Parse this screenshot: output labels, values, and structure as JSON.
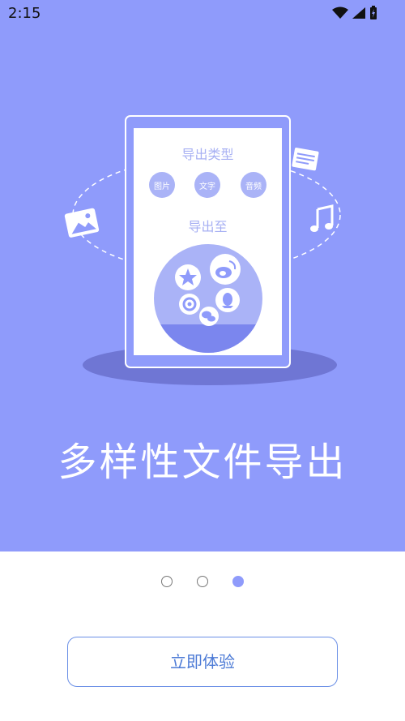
{
  "status_bar": {
    "time": "2:15",
    "icons": [
      "wifi-icon",
      "cellular-signal-icon",
      "battery-charging-icon"
    ]
  },
  "illustration": {
    "export_type_title": "导出类型",
    "type_options": [
      "图片",
      "文字",
      "音频"
    ],
    "export_to_title": "导出至",
    "share_targets": [
      "qzone-icon",
      "weibo-icon",
      "qq-icon",
      "camera-shutter-icon",
      "wechat-icon"
    ],
    "decor_icons": [
      "image-icon",
      "document-icon",
      "music-note-icon"
    ]
  },
  "headline": "多样性文件导出",
  "pager": {
    "count": 3,
    "active_index": 2
  },
  "cta": {
    "label": "立即体验"
  },
  "colors": {
    "hero_bg": "#8f9bfb",
    "accent": "#8f9bfb",
    "button_text": "#4d7bd6"
  }
}
